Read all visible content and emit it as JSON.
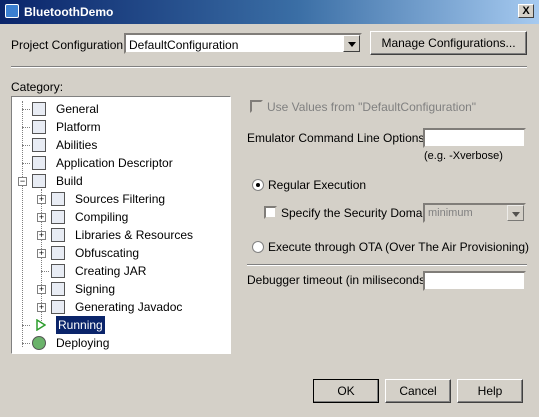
{
  "window": {
    "title": "BluetoothDemo",
    "close_label": "X"
  },
  "project": {
    "label": "Project Configuration:",
    "value": "DefaultConfiguration",
    "manage_button": "Manage Configurations..."
  },
  "category": {
    "label": "Category:",
    "items": [
      {
        "label": "General",
        "icon": "document-settings-icon"
      },
      {
        "label": "Platform",
        "icon": "platform-icon"
      },
      {
        "label": "Abilities",
        "icon": "abilities-icon"
      },
      {
        "label": "Application Descriptor",
        "icon": "descriptor-icon"
      },
      {
        "label": "Build",
        "icon": "build-icon"
      },
      {
        "label": "Sources Filtering",
        "icon": "filter-icon"
      },
      {
        "label": "Compiling",
        "icon": "compile-icon"
      },
      {
        "label": "Libraries & Resources",
        "icon": "libraries-icon"
      },
      {
        "label": "Obfuscating",
        "icon": "obfuscate-icon"
      },
      {
        "label": "Creating JAR",
        "icon": "jar-icon"
      },
      {
        "label": "Signing",
        "icon": "signing-icon"
      },
      {
        "label": "Generating Javadoc",
        "icon": "javadoc-icon"
      },
      {
        "label": "Running",
        "icon": "run-arrow-icon"
      },
      {
        "label": "Deploying",
        "icon": "deploy-globe-icon"
      }
    ],
    "selected": "Running"
  },
  "settings": {
    "use_values": "Use Values from \"DefaultConfiguration\"",
    "emulator_label": "Emulator Command Line Options:",
    "emulator_value": "",
    "emulator_hint": "(e.g. -Xverbose)",
    "regular_execution": "Regular Execution",
    "security_domain": "Specify the Security Domain:",
    "security_value": "minimum",
    "execute_ota": "Execute through OTA (Over The Air Provisioning)",
    "debugger_label": "Debugger timeout (in miliseconds):",
    "debugger_value": ""
  },
  "buttons": {
    "ok": "OK",
    "cancel": "Cancel",
    "help": "Help"
  }
}
